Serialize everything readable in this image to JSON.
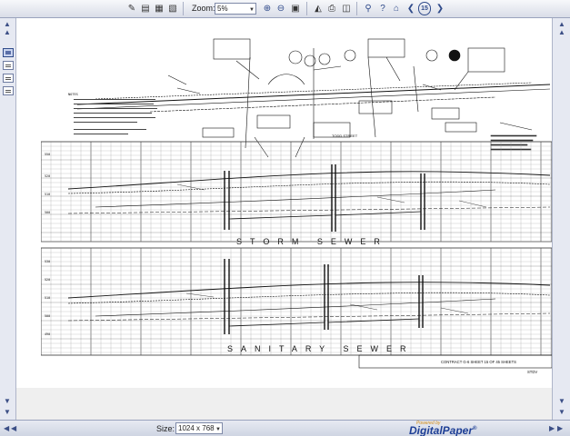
{
  "toolbar": {
    "zoom_label": "Zoom:",
    "zoom_value": "5%",
    "icons": [
      "select-tool-icon",
      "text-tool-icon",
      "thumbnail-view-icon",
      "page-view-icon",
      "zoom-in-icon",
      "zoom-out-icon",
      "fit-page-icon",
      "open-icon",
      "print-icon",
      "save-icon",
      "search-icon",
      "help-icon",
      "home-icon",
      "back-icon",
      "page-number-icon",
      "forward-icon"
    ],
    "page_number_glyph": "15"
  },
  "document": {
    "street_label": "TODD STREET",
    "storm_label": "STORM SEWER",
    "sanitary_label": "SANITARY SEWER",
    "title_block": "CONTRACT G-6  SHEET 15 OF 45 SHEETS",
    "drawing_no": "STDV",
    "notes_heading": "NOTES",
    "elev_left_upper": [
      "550",
      "520",
      "510",
      "500"
    ],
    "elev_left_lower": [
      "530",
      "520",
      "510",
      "500",
      "490"
    ]
  },
  "statusbar": {
    "size_label": "Size:",
    "size_value": "1024 x 768",
    "brand_small": "Powered by",
    "brand_name": "DigitalPaper",
    "brand_mark": "®"
  }
}
